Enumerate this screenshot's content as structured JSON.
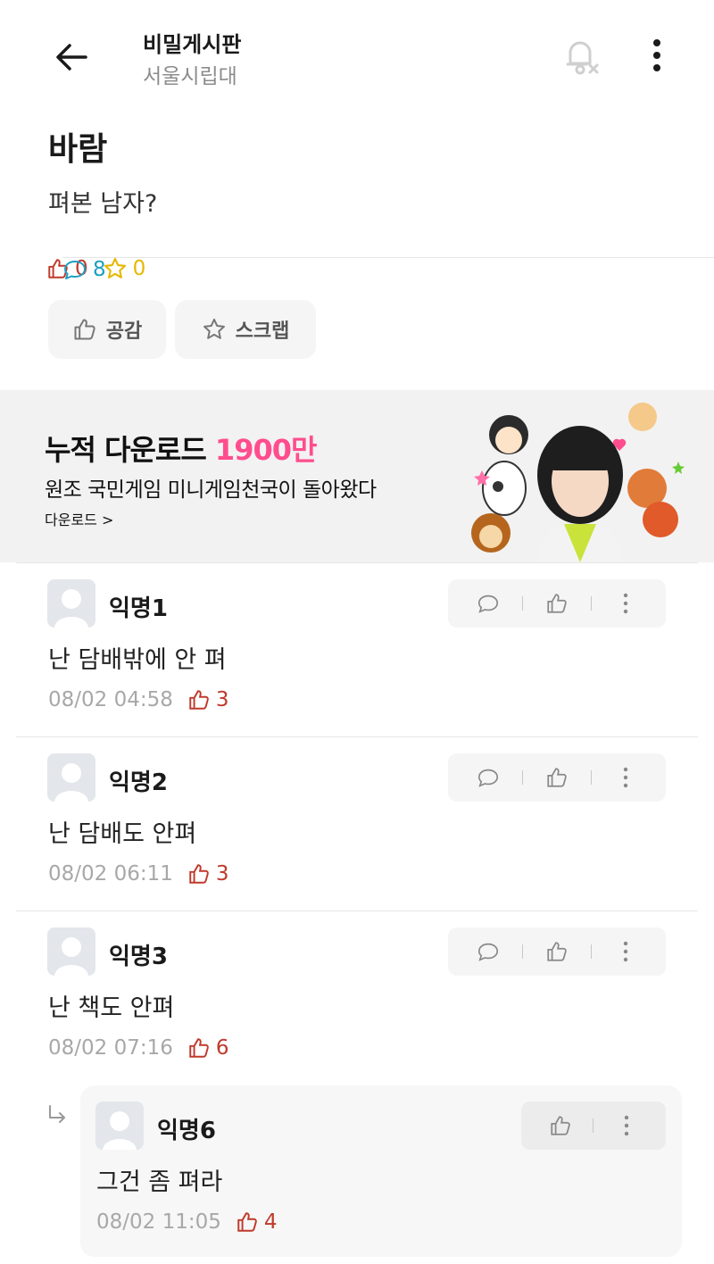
{
  "header": {
    "back_icon": "arrow-left-icon",
    "title": "비밀게시판",
    "subtitle": "서울시립대",
    "notify_icon": "bell-off-icon",
    "more_icon": "more-vertical-icon"
  },
  "post": {
    "title": "바람",
    "body": "펴본 남자?",
    "likes": "0",
    "comments": "8",
    "scraps": "0",
    "like_button": "공감",
    "scrap_button": "스크랩"
  },
  "ad": {
    "headline": "누적 다운로드 ",
    "headline_highlight": "1900만",
    "subline": "원조 국민게임 미니게임천국이 돌아왔다",
    "link": "다운로드 >"
  },
  "comments": [
    {
      "name": "익명1",
      "text": "난 담배밖에 안 펴",
      "time": "08/02 04:58",
      "likes": "3"
    },
    {
      "name": "익명2",
      "text": "난 담배도 안펴",
      "time": "08/02 06:11",
      "likes": "3"
    },
    {
      "name": "익명3",
      "text": "난 책도 안펴",
      "time": "08/02 07:16",
      "likes": "6"
    }
  ],
  "reply": {
    "name": "익명6",
    "text": "그건 좀 펴라",
    "time": "08/02 11:05",
    "likes": "4"
  },
  "colors": {
    "like": "#c0392b",
    "comment": "#1f9ec0",
    "scrap": "#e6b800",
    "ad_highlight": "#ff4d8d"
  }
}
